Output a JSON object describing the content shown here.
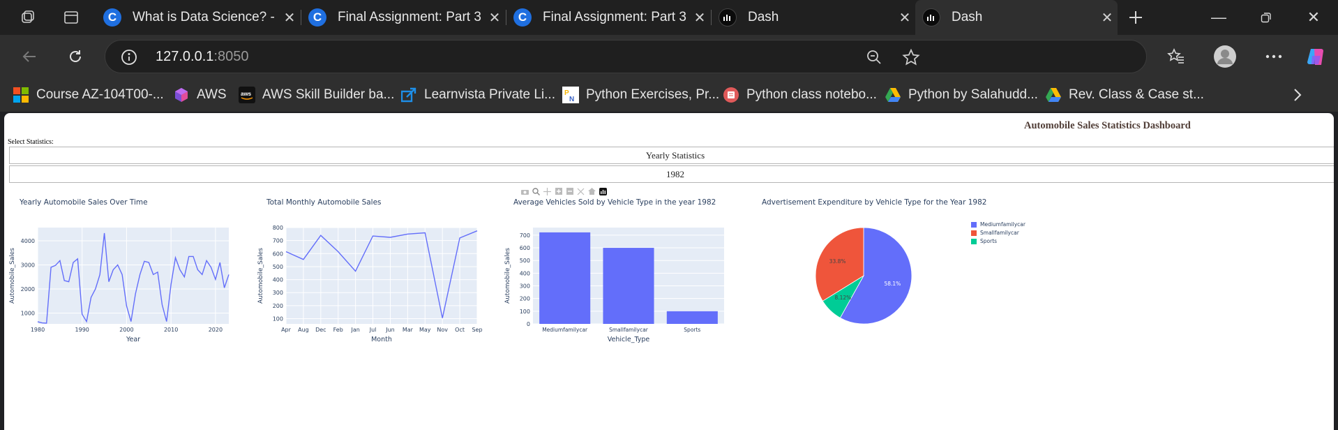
{
  "browser": {
    "tabs": [
      {
        "title": "What is Data Science? - D",
        "favicon": "coursera-icon"
      },
      {
        "title": "Final Assignment: Part 3 -",
        "favicon": "coursera-icon"
      },
      {
        "title": "Final Assignment: Part 3 -",
        "favicon": "coursera-icon"
      },
      {
        "title": "Dash",
        "favicon": "dash-icon"
      },
      {
        "title": "Dash",
        "favicon": "dash-icon",
        "active": true
      }
    ],
    "address": {
      "host": "127.0.0.1",
      "port": ":8050"
    },
    "bookmarks": [
      {
        "label": "Course AZ-104T00-...",
        "icon": "microsoft-icon"
      },
      {
        "label": "AWS",
        "icon": "aws-cube-icon"
      },
      {
        "label": "AWS Skill Builder ba...",
        "icon": "aws-icon"
      },
      {
        "label": "Learnvista Private Li...",
        "icon": "learnvista-icon"
      },
      {
        "label": "Python Exercises, Pr...",
        "icon": "pynative-icon"
      },
      {
        "label": "Python class notebo...",
        "icon": "notebook-icon"
      },
      {
        "label": "Python by Salahudd...",
        "icon": "google-drive-icon"
      },
      {
        "label": "Rev. Class & Case st...",
        "icon": "google-drive-icon"
      }
    ]
  },
  "dashboard": {
    "title": "Automobile Sales Statistics Dashboard",
    "select_label": "Select Statistics:",
    "statistics_value": "Yearly Statistics",
    "year_value": "1982"
  },
  "colors": {
    "primary": "#636efa",
    "secondary": "#ef553b",
    "tertiary": "#00cc96",
    "plot_bg": "#e5ecf6",
    "title": "#503d36"
  },
  "chart_data": [
    {
      "type": "line",
      "title": "Yearly Automobile Sales Over Time",
      "xlabel": "Year",
      "ylabel": "Automobile_Sales",
      "x": [
        1980,
        1981,
        1982,
        1983,
        1984,
        1985,
        1986,
        1987,
        1988,
        1989,
        1990,
        1991,
        1992,
        1993,
        1994,
        1995,
        1996,
        1997,
        1998,
        1999,
        2000,
        2001,
        2002,
        2003,
        2004,
        2005,
        2006,
        2007,
        2008,
        2009,
        2010,
        2011,
        2012,
        2013,
        2014,
        2015,
        2016,
        2017,
        2018,
        2019,
        2020,
        2021,
        2022,
        2023
      ],
      "values": [
        640,
        590,
        580,
        2900,
        2980,
        3180,
        2350,
        2300,
        3100,
        3250,
        950,
        650,
        1650,
        2000,
        2600,
        4320,
        2300,
        2800,
        3000,
        2600,
        1300,
        650,
        1800,
        2600,
        3150,
        3100,
        2600,
        2700,
        1350,
        650,
        2200,
        3300,
        2800,
        2500,
        3350,
        3350,
        2800,
        2600,
        3180,
        2900,
        2400,
        3100,
        2050,
        2600
      ],
      "xticks": [
        1980,
        1990,
        2000,
        2010,
        2020
      ],
      "yticks": [
        1000,
        2000,
        3000,
        4000
      ],
      "xlim": [
        1980,
        2023
      ],
      "ylim": [
        550,
        4550
      ]
    },
    {
      "type": "line",
      "title": "Total Monthly Automobile Sales",
      "xlabel": "Month",
      "ylabel": "Automobile_Sales",
      "categories": [
        "Apr",
        "Aug",
        "Dec",
        "Feb",
        "Jan",
        "Jul",
        "Jun",
        "Mar",
        "May",
        "Nov",
        "Oct",
        "Sep"
      ],
      "values": [
        615,
        555,
        740,
        615,
        465,
        735,
        725,
        750,
        760,
        105,
        720,
        775
      ],
      "yticks": [
        100,
        200,
        300,
        400,
        500,
        600,
        700,
        800
      ],
      "ylim": [
        60,
        800
      ]
    },
    {
      "type": "bar",
      "title": "Average Vehicles Sold by Vehicle Type in the year 1982",
      "xlabel": "Vehicle_Type",
      "ylabel": "Automobile_Sales",
      "categories": [
        "Mediumfamilycar",
        "Smallfamilycar",
        "Sports"
      ],
      "values": [
        722,
        600,
        100
      ],
      "yticks": [
        0,
        100,
        200,
        300,
        400,
        500,
        600,
        700
      ],
      "ylim": [
        0,
        760
      ]
    },
    {
      "type": "pie",
      "title": "Advertisement Expenditure by Vehicle Type for the Year 1982",
      "labels": [
        "Mediumfamilycar",
        "Smallfamilycar",
        "Sports"
      ],
      "values": [
        58.1,
        33.8,
        8.12
      ],
      "display": [
        "58.1%",
        "33.8%",
        "8.12%"
      ],
      "legend": "right"
    }
  ]
}
